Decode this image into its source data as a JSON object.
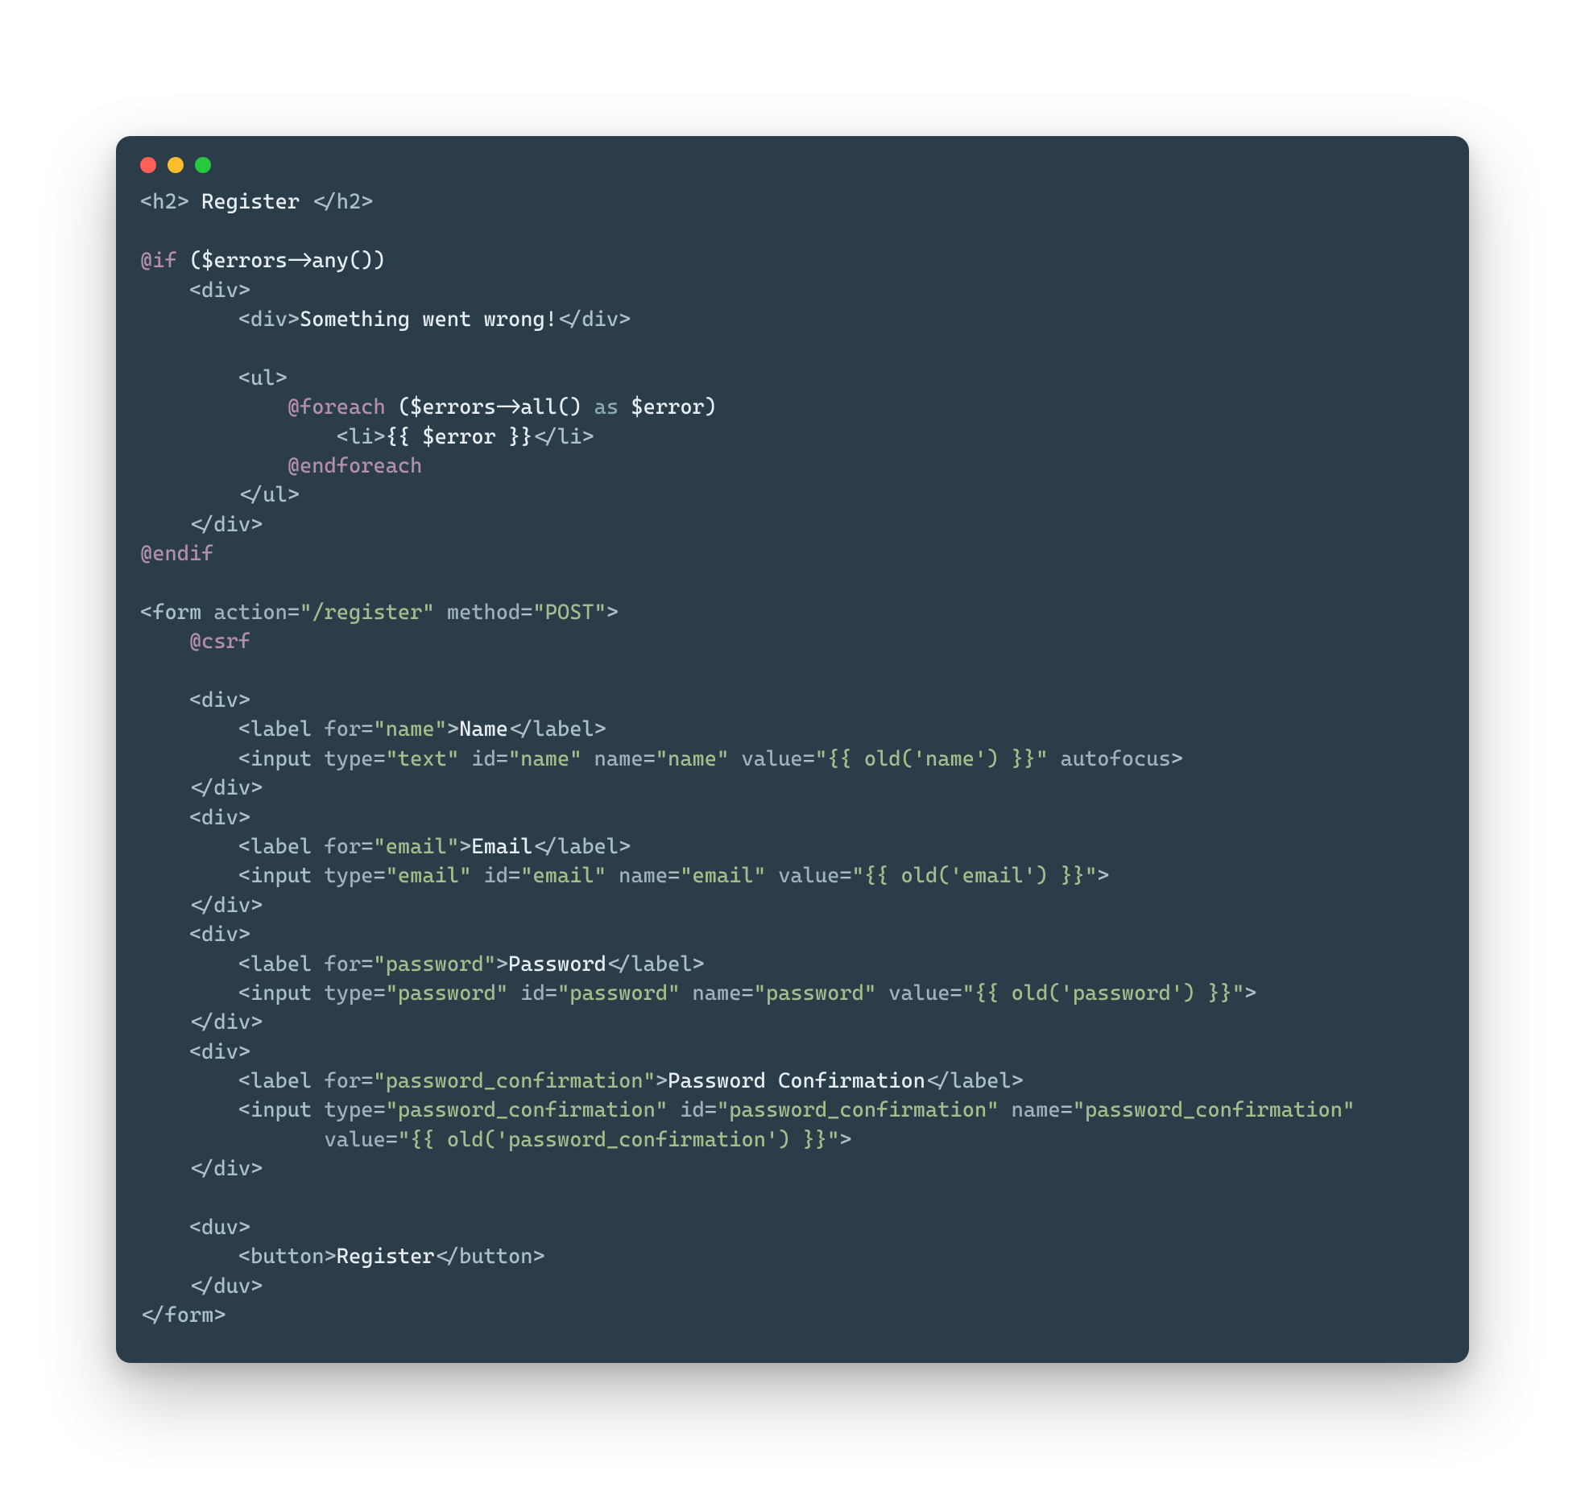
{
  "colors": {
    "bg": "#2b3d48",
    "fg": "#e8eef1",
    "tag": "#a8c1c9",
    "punct": "#b0bec5",
    "attr": "#9eb2bb",
    "string": "#a3be8c",
    "directive": "#b48ead",
    "dots": {
      "red": "#ff5f56",
      "yellow": "#ffbd2e",
      "green": "#27c93f"
    }
  },
  "lines": [
    {
      "indent": 0,
      "tokens": [
        {
          "c": "t2",
          "t": "<"
        },
        {
          "c": "t",
          "t": "h2"
        },
        {
          "c": "t2",
          "t": ">"
        },
        {
          "c": "p",
          "t": " Register "
        },
        {
          "c": "t2",
          "t": "</"
        },
        {
          "c": "t",
          "t": "h2"
        },
        {
          "c": "t2",
          "t": ">"
        }
      ]
    },
    {
      "indent": 0,
      "tokens": []
    },
    {
      "indent": 0,
      "tokens": [
        {
          "c": "d",
          "t": "@if"
        },
        {
          "c": "p",
          "t": " ($errors->any())"
        }
      ]
    },
    {
      "indent": 4,
      "tokens": [
        {
          "c": "t2",
          "t": "<"
        },
        {
          "c": "t",
          "t": "div"
        },
        {
          "c": "t2",
          "t": ">"
        }
      ]
    },
    {
      "indent": 8,
      "tokens": [
        {
          "c": "t2",
          "t": "<"
        },
        {
          "c": "t",
          "t": "div"
        },
        {
          "c": "t2",
          "t": ">"
        },
        {
          "c": "p",
          "t": "Something went wrong!"
        },
        {
          "c": "t2",
          "t": "</"
        },
        {
          "c": "t",
          "t": "div"
        },
        {
          "c": "t2",
          "t": ">"
        }
      ]
    },
    {
      "indent": 0,
      "tokens": []
    },
    {
      "indent": 8,
      "tokens": [
        {
          "c": "t2",
          "t": "<"
        },
        {
          "c": "t",
          "t": "ul"
        },
        {
          "c": "t2",
          "t": ">"
        }
      ]
    },
    {
      "indent": 12,
      "tokens": [
        {
          "c": "d",
          "t": "@foreach"
        },
        {
          "c": "p",
          "t": " ($errors->all() "
        },
        {
          "c": "k",
          "t": "as"
        },
        {
          "c": "p",
          "t": " $error)"
        }
      ]
    },
    {
      "indent": 16,
      "tokens": [
        {
          "c": "t2",
          "t": "<"
        },
        {
          "c": "t",
          "t": "li"
        },
        {
          "c": "t2",
          "t": ">"
        },
        {
          "c": "p",
          "t": "{{ $error }}"
        },
        {
          "c": "t2",
          "t": "</"
        },
        {
          "c": "t",
          "t": "li"
        },
        {
          "c": "t2",
          "t": ">"
        }
      ]
    },
    {
      "indent": 12,
      "tokens": [
        {
          "c": "d",
          "t": "@endforeach"
        }
      ]
    },
    {
      "indent": 8,
      "tokens": [
        {
          "c": "t2",
          "t": "</"
        },
        {
          "c": "t",
          "t": "ul"
        },
        {
          "c": "t2",
          "t": ">"
        }
      ]
    },
    {
      "indent": 4,
      "tokens": [
        {
          "c": "t2",
          "t": "</"
        },
        {
          "c": "t",
          "t": "div"
        },
        {
          "c": "t2",
          "t": ">"
        }
      ]
    },
    {
      "indent": 0,
      "tokens": [
        {
          "c": "d",
          "t": "@endif"
        }
      ]
    },
    {
      "indent": 0,
      "tokens": []
    },
    {
      "indent": 0,
      "tokens": [
        {
          "c": "t2",
          "t": "<"
        },
        {
          "c": "t",
          "t": "form"
        },
        {
          "c": "p",
          "t": " "
        },
        {
          "c": "a",
          "t": "action"
        },
        {
          "c": "t2",
          "t": "="
        },
        {
          "c": "s",
          "t": "\"/register\""
        },
        {
          "c": "p",
          "t": " "
        },
        {
          "c": "a",
          "t": "method"
        },
        {
          "c": "t2",
          "t": "="
        },
        {
          "c": "s",
          "t": "\"POST\""
        },
        {
          "c": "t2",
          "t": ">"
        }
      ]
    },
    {
      "indent": 4,
      "tokens": [
        {
          "c": "d",
          "t": "@csrf"
        }
      ]
    },
    {
      "indent": 0,
      "tokens": []
    },
    {
      "indent": 4,
      "tokens": [
        {
          "c": "t2",
          "t": "<"
        },
        {
          "c": "t",
          "t": "div"
        },
        {
          "c": "t2",
          "t": ">"
        }
      ]
    },
    {
      "indent": 8,
      "tokens": [
        {
          "c": "t2",
          "t": "<"
        },
        {
          "c": "t",
          "t": "label"
        },
        {
          "c": "p",
          "t": " "
        },
        {
          "c": "a",
          "t": "for"
        },
        {
          "c": "t2",
          "t": "="
        },
        {
          "c": "s",
          "t": "\"name\""
        },
        {
          "c": "t2",
          "t": ">"
        },
        {
          "c": "p",
          "t": "Name"
        },
        {
          "c": "t2",
          "t": "</"
        },
        {
          "c": "t",
          "t": "label"
        },
        {
          "c": "t2",
          "t": ">"
        }
      ]
    },
    {
      "indent": 8,
      "tokens": [
        {
          "c": "t2",
          "t": "<"
        },
        {
          "c": "t",
          "t": "input"
        },
        {
          "c": "p",
          "t": " "
        },
        {
          "c": "a",
          "t": "type"
        },
        {
          "c": "t2",
          "t": "="
        },
        {
          "c": "s",
          "t": "\"text\""
        },
        {
          "c": "p",
          "t": " "
        },
        {
          "c": "a",
          "t": "id"
        },
        {
          "c": "t2",
          "t": "="
        },
        {
          "c": "s",
          "t": "\"name\""
        },
        {
          "c": "p",
          "t": " "
        },
        {
          "c": "a",
          "t": "name"
        },
        {
          "c": "t2",
          "t": "="
        },
        {
          "c": "s",
          "t": "\"name\""
        },
        {
          "c": "p",
          "t": " "
        },
        {
          "c": "a",
          "t": "value"
        },
        {
          "c": "t2",
          "t": "="
        },
        {
          "c": "s",
          "t": "\"{{ old('name') }}\""
        },
        {
          "c": "p",
          "t": " "
        },
        {
          "c": "a",
          "t": "autofocus"
        },
        {
          "c": "t2",
          "t": ">"
        }
      ]
    },
    {
      "indent": 4,
      "tokens": [
        {
          "c": "t2",
          "t": "</"
        },
        {
          "c": "t",
          "t": "div"
        },
        {
          "c": "t2",
          "t": ">"
        }
      ]
    },
    {
      "indent": 4,
      "tokens": [
        {
          "c": "t2",
          "t": "<"
        },
        {
          "c": "t",
          "t": "div"
        },
        {
          "c": "t2",
          "t": ">"
        }
      ]
    },
    {
      "indent": 8,
      "tokens": [
        {
          "c": "t2",
          "t": "<"
        },
        {
          "c": "t",
          "t": "label"
        },
        {
          "c": "p",
          "t": " "
        },
        {
          "c": "a",
          "t": "for"
        },
        {
          "c": "t2",
          "t": "="
        },
        {
          "c": "s",
          "t": "\"email\""
        },
        {
          "c": "t2",
          "t": ">"
        },
        {
          "c": "p",
          "t": "Email"
        },
        {
          "c": "t2",
          "t": "</"
        },
        {
          "c": "t",
          "t": "label"
        },
        {
          "c": "t2",
          "t": ">"
        }
      ]
    },
    {
      "indent": 8,
      "tokens": [
        {
          "c": "t2",
          "t": "<"
        },
        {
          "c": "t",
          "t": "input"
        },
        {
          "c": "p",
          "t": " "
        },
        {
          "c": "a",
          "t": "type"
        },
        {
          "c": "t2",
          "t": "="
        },
        {
          "c": "s",
          "t": "\"email\""
        },
        {
          "c": "p",
          "t": " "
        },
        {
          "c": "a",
          "t": "id"
        },
        {
          "c": "t2",
          "t": "="
        },
        {
          "c": "s",
          "t": "\"email\""
        },
        {
          "c": "p",
          "t": " "
        },
        {
          "c": "a",
          "t": "name"
        },
        {
          "c": "t2",
          "t": "="
        },
        {
          "c": "s",
          "t": "\"email\""
        },
        {
          "c": "p",
          "t": " "
        },
        {
          "c": "a",
          "t": "value"
        },
        {
          "c": "t2",
          "t": "="
        },
        {
          "c": "s",
          "t": "\"{{ old('email') }}\""
        },
        {
          "c": "t2",
          "t": ">"
        }
      ]
    },
    {
      "indent": 4,
      "tokens": [
        {
          "c": "t2",
          "t": "</"
        },
        {
          "c": "t",
          "t": "div"
        },
        {
          "c": "t2",
          "t": ">"
        }
      ]
    },
    {
      "indent": 4,
      "tokens": [
        {
          "c": "t2",
          "t": "<"
        },
        {
          "c": "t",
          "t": "div"
        },
        {
          "c": "t2",
          "t": ">"
        }
      ]
    },
    {
      "indent": 8,
      "tokens": [
        {
          "c": "t2",
          "t": "<"
        },
        {
          "c": "t",
          "t": "label"
        },
        {
          "c": "p",
          "t": " "
        },
        {
          "c": "a",
          "t": "for"
        },
        {
          "c": "t2",
          "t": "="
        },
        {
          "c": "s",
          "t": "\"password\""
        },
        {
          "c": "t2",
          "t": ">"
        },
        {
          "c": "p",
          "t": "Password"
        },
        {
          "c": "t2",
          "t": "</"
        },
        {
          "c": "t",
          "t": "label"
        },
        {
          "c": "t2",
          "t": ">"
        }
      ]
    },
    {
      "indent": 8,
      "tokens": [
        {
          "c": "t2",
          "t": "<"
        },
        {
          "c": "t",
          "t": "input"
        },
        {
          "c": "p",
          "t": " "
        },
        {
          "c": "a",
          "t": "type"
        },
        {
          "c": "t2",
          "t": "="
        },
        {
          "c": "s",
          "t": "\"password\""
        },
        {
          "c": "p",
          "t": " "
        },
        {
          "c": "a",
          "t": "id"
        },
        {
          "c": "t2",
          "t": "="
        },
        {
          "c": "s",
          "t": "\"password\""
        },
        {
          "c": "p",
          "t": " "
        },
        {
          "c": "a",
          "t": "name"
        },
        {
          "c": "t2",
          "t": "="
        },
        {
          "c": "s",
          "t": "\"password\""
        },
        {
          "c": "p",
          "t": " "
        },
        {
          "c": "a",
          "t": "value"
        },
        {
          "c": "t2",
          "t": "="
        },
        {
          "c": "s",
          "t": "\"{{ old('password') }}\""
        },
        {
          "c": "t2",
          "t": ">"
        }
      ]
    },
    {
      "indent": 4,
      "tokens": [
        {
          "c": "t2",
          "t": "</"
        },
        {
          "c": "t",
          "t": "div"
        },
        {
          "c": "t2",
          "t": ">"
        }
      ]
    },
    {
      "indent": 4,
      "tokens": [
        {
          "c": "t2",
          "t": "<"
        },
        {
          "c": "t",
          "t": "div"
        },
        {
          "c": "t2",
          "t": ">"
        }
      ]
    },
    {
      "indent": 8,
      "tokens": [
        {
          "c": "t2",
          "t": "<"
        },
        {
          "c": "t",
          "t": "label"
        },
        {
          "c": "p",
          "t": " "
        },
        {
          "c": "a",
          "t": "for"
        },
        {
          "c": "t2",
          "t": "="
        },
        {
          "c": "s",
          "t": "\"password_confirmation\""
        },
        {
          "c": "t2",
          "t": ">"
        },
        {
          "c": "p",
          "t": "Password Confirmation"
        },
        {
          "c": "t2",
          "t": "</"
        },
        {
          "c": "t",
          "t": "label"
        },
        {
          "c": "t2",
          "t": ">"
        }
      ]
    },
    {
      "indent": 8,
      "tokens": [
        {
          "c": "t2",
          "t": "<"
        },
        {
          "c": "t",
          "t": "input"
        },
        {
          "c": "p",
          "t": " "
        },
        {
          "c": "a",
          "t": "type"
        },
        {
          "c": "t2",
          "t": "="
        },
        {
          "c": "s",
          "t": "\"password_confirmation\""
        },
        {
          "c": "p",
          "t": " "
        },
        {
          "c": "a",
          "t": "id"
        },
        {
          "c": "t2",
          "t": "="
        },
        {
          "c": "s",
          "t": "\"password_confirmation\""
        },
        {
          "c": "p",
          "t": " "
        },
        {
          "c": "a",
          "t": "name"
        },
        {
          "c": "t2",
          "t": "="
        },
        {
          "c": "s",
          "t": "\"password_confirmation\""
        }
      ]
    },
    {
      "indent": 15,
      "tokens": [
        {
          "c": "a",
          "t": "value"
        },
        {
          "c": "t2",
          "t": "="
        },
        {
          "c": "s",
          "t": "\"{{ old('password_confirmation') }}\""
        },
        {
          "c": "t2",
          "t": ">"
        }
      ]
    },
    {
      "indent": 4,
      "tokens": [
        {
          "c": "t2",
          "t": "</"
        },
        {
          "c": "t",
          "t": "div"
        },
        {
          "c": "t2",
          "t": ">"
        }
      ]
    },
    {
      "indent": 0,
      "tokens": []
    },
    {
      "indent": 4,
      "tokens": [
        {
          "c": "t2",
          "t": "<"
        },
        {
          "c": "t",
          "t": "duv"
        },
        {
          "c": "t2",
          "t": ">"
        }
      ]
    },
    {
      "indent": 8,
      "tokens": [
        {
          "c": "t2",
          "t": "<"
        },
        {
          "c": "t",
          "t": "button"
        },
        {
          "c": "t2",
          "t": ">"
        },
        {
          "c": "p",
          "t": "Register"
        },
        {
          "c": "t2",
          "t": "</"
        },
        {
          "c": "t",
          "t": "button"
        },
        {
          "c": "t2",
          "t": ">"
        }
      ]
    },
    {
      "indent": 4,
      "tokens": [
        {
          "c": "t2",
          "t": "</"
        },
        {
          "c": "t",
          "t": "duv"
        },
        {
          "c": "t2",
          "t": ">"
        }
      ]
    },
    {
      "indent": 0,
      "tokens": [
        {
          "c": "t2",
          "t": "</"
        },
        {
          "c": "t",
          "t": "form"
        },
        {
          "c": "t2",
          "t": ">"
        }
      ]
    }
  ]
}
